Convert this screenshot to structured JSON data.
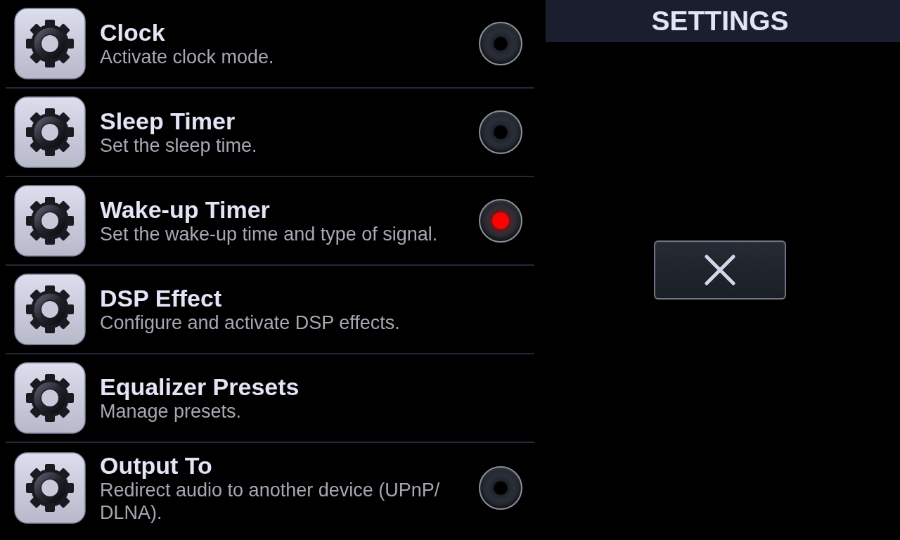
{
  "settings_list": {
    "items": [
      {
        "kind": "toggle",
        "title": "Clock",
        "subtitle": "Activate clock mode.",
        "on": false
      },
      {
        "kind": "toggle",
        "title": "Sleep Timer",
        "subtitle": "Set the sleep time.",
        "on": false
      },
      {
        "kind": "toggle",
        "title": "Wake-up Timer",
        "subtitle": "Set the wake-up time and type of signal.",
        "on": true
      },
      {
        "kind": "action",
        "title": "DSP Effect",
        "subtitle": "Configure and activate DSP effects."
      },
      {
        "kind": "action",
        "title": "Equalizer Presets",
        "subtitle": "Manage presets."
      },
      {
        "kind": "toggle",
        "title": "Output To",
        "subtitle": "Redirect audio to another device (UPnP/DLNA).",
        "on": false
      }
    ]
  },
  "panel": {
    "title": "SETTINGS"
  }
}
